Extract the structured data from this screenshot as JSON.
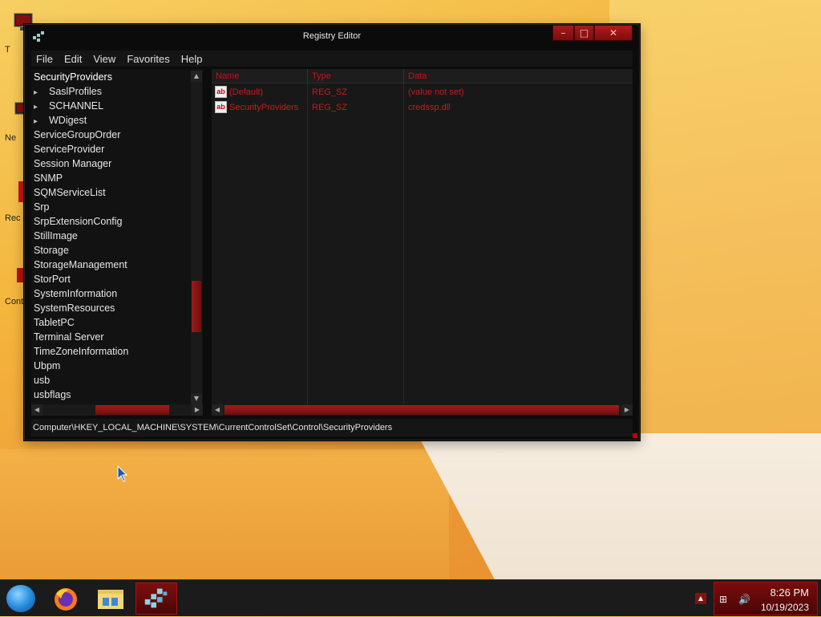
{
  "window": {
    "title": "Registry Editor",
    "buttons": {
      "minimize": "–",
      "maximize": "□",
      "close": "✕"
    }
  },
  "menu": [
    "File",
    "Edit",
    "View",
    "Favorites",
    "Help"
  ],
  "tree": {
    "items": [
      {
        "label": "SecurityProviders",
        "selected": true,
        "child": false
      },
      {
        "label": "SaslProfiles",
        "child": true
      },
      {
        "label": "SCHANNEL",
        "child": true
      },
      {
        "label": "WDigest",
        "child": true
      },
      {
        "label": "ServiceGroupOrder",
        "child": false
      },
      {
        "label": "ServiceProvider",
        "child": false
      },
      {
        "label": "Session Manager",
        "child": false
      },
      {
        "label": "SNMP",
        "child": false
      },
      {
        "label": "SQMServiceList",
        "child": false
      },
      {
        "label": "Srp",
        "child": false
      },
      {
        "label": "SrpExtensionConfig",
        "child": false
      },
      {
        "label": "StillImage",
        "child": false
      },
      {
        "label": "Storage",
        "child": false
      },
      {
        "label": "StorageManagement",
        "child": false
      },
      {
        "label": "StorPort",
        "child": false
      },
      {
        "label": "SystemInformation",
        "child": false
      },
      {
        "label": "SystemResources",
        "child": false
      },
      {
        "label": "TabletPC",
        "child": false
      },
      {
        "label": "Terminal Server",
        "child": false
      },
      {
        "label": "TimeZoneInformation",
        "child": false
      },
      {
        "label": "Ubpm",
        "child": false
      },
      {
        "label": "usb",
        "child": false
      },
      {
        "label": "usbflags",
        "child": false
      }
    ]
  },
  "list": {
    "columns": [
      "Name",
      "Type",
      "Data"
    ],
    "rows": [
      {
        "name": "(Default)",
        "type": "REG_SZ",
        "data": "(value not set)"
      },
      {
        "name": "SecurityProviders",
        "type": "REG_SZ",
        "data": "credssp.dll"
      }
    ],
    "value_icon": "ab"
  },
  "status_path": "Computer\\HKEY_LOCAL_MACHINE\\SYSTEM\\CurrentControlSet\\Control\\SecurityProviders",
  "taskbar": {
    "apps": [
      "start-orb-icon",
      "firefox-icon",
      "file-explorer-icon",
      "registry-editor-icon"
    ],
    "clock_time": "8:26 PM",
    "clock_date": "10/19/2023"
  },
  "desktop_icons": [
    {
      "label": "T",
      "icon": "computer-icon"
    },
    {
      "label": "Ne",
      "icon": "network-icon"
    },
    {
      "label": "Rec",
      "icon": "recycle-bin-icon"
    },
    {
      "label": "Cont",
      "icon": "control-panel-icon"
    }
  ],
  "colors": {
    "accent": "#b01414",
    "window_bg": "#121212",
    "text": "#e6e6e6",
    "value_text": "#c41c1c"
  }
}
